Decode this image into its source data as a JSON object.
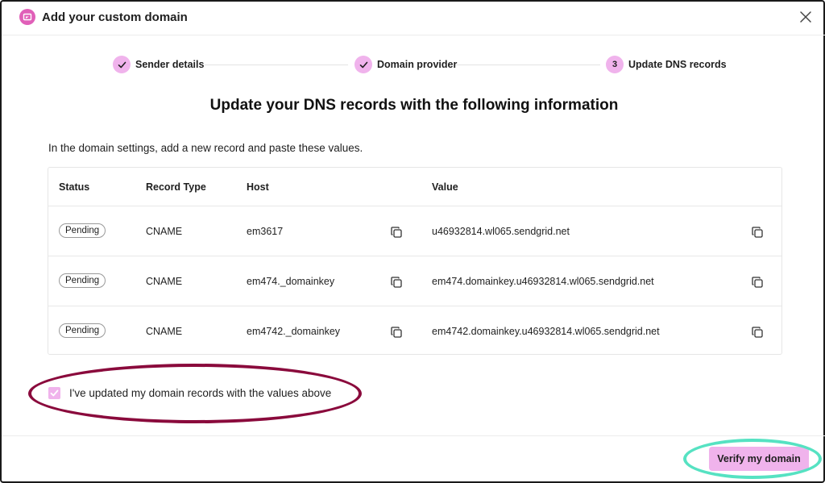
{
  "modal": {
    "title": "Add your custom domain"
  },
  "stepper": {
    "steps": [
      {
        "label": "Sender details",
        "state": "completed"
      },
      {
        "label": "Domain provider",
        "state": "completed"
      },
      {
        "label": "Update DNS records",
        "state": "active",
        "number": "3"
      }
    ]
  },
  "main": {
    "heading": "Update your DNS records with the following information",
    "instructions": "In the domain settings, add a new record and paste these values."
  },
  "table": {
    "headers": [
      "Status",
      "Record Type",
      "Host",
      "Value"
    ],
    "rows": [
      {
        "status": "Pending",
        "type": "CNAME",
        "host": "em3617",
        "value": "u46932814.wl065.sendgrid.net"
      },
      {
        "status": "Pending",
        "type": "CNAME",
        "host": "em474._domainkey",
        "value": "em474.domainkey.u46932814.wl065.sendgrid.net"
      },
      {
        "status": "Pending",
        "type": "CNAME",
        "host": "em4742._domainkey",
        "value": "em4742.domainkey.u46932814.wl065.sendgrid.net"
      }
    ]
  },
  "confirm": {
    "checked": true,
    "label": "I've updated my domain records with the values above"
  },
  "footer": {
    "verify_label": "Verify my domain"
  },
  "colors": {
    "accent": "#f0b3ec",
    "brand": "#e05fb8",
    "annotation_red": "#8a0a3c",
    "annotation_teal": "#56e2c2"
  },
  "icons": {
    "logo": "brand-logo-icon",
    "close": "close-icon",
    "check": "check-icon",
    "copy": "copy-icon"
  }
}
